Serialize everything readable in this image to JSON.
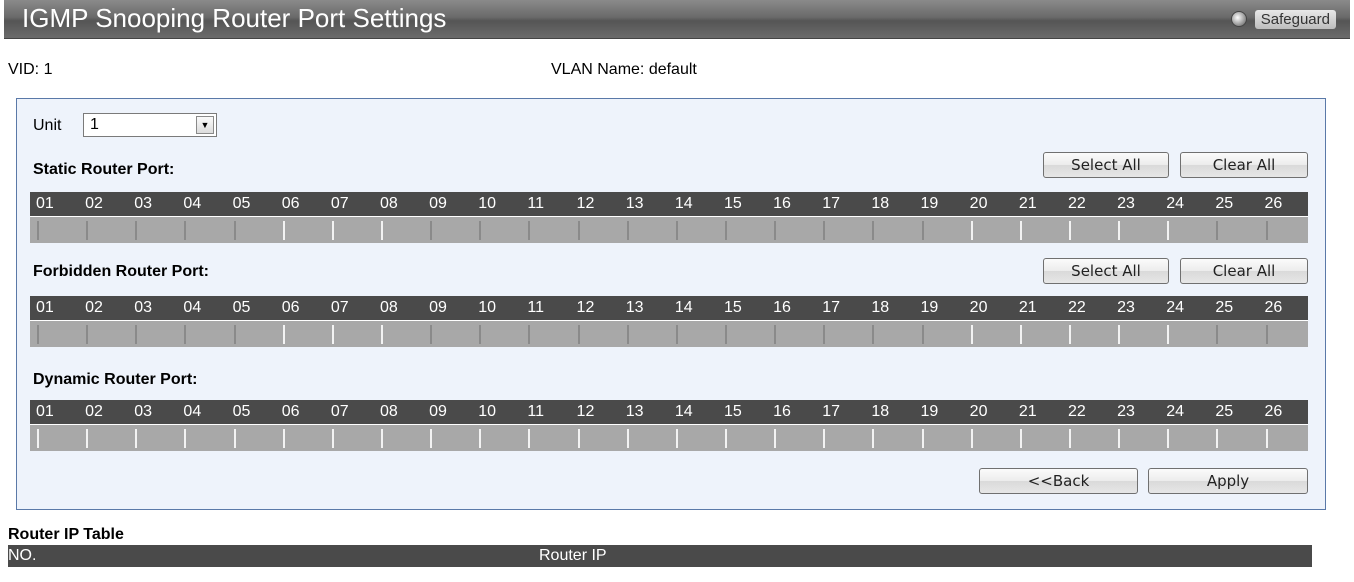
{
  "title": "IGMP Snooping Router Port Settings",
  "safeguard": "Safeguard",
  "vid": "VID:  1",
  "vlan_name": "VLAN Name:  default",
  "unit": {
    "label": "Unit",
    "value": "1"
  },
  "sections": [
    {
      "label": "Static Router Port:",
      "select_all": "Select All",
      "clear_all": "Clear All",
      "ports": [
        "01",
        "02",
        "03",
        "04",
        "05",
        "06",
        "07",
        "08",
        "09",
        "10",
        "11",
        "12",
        "13",
        "14",
        "15",
        "16",
        "17",
        "18",
        "19",
        "20",
        "21",
        "22",
        "23",
        "24",
        "25",
        "26"
      ],
      "enabled": [
        true,
        true,
        true,
        true,
        true,
        false,
        false,
        false,
        true,
        true,
        true,
        true,
        true,
        true,
        true,
        true,
        true,
        true,
        true,
        false,
        false,
        false,
        false,
        false,
        true,
        true
      ]
    },
    {
      "label": "Forbidden Router Port:",
      "select_all": "Select All",
      "clear_all": "Clear All",
      "ports": [
        "01",
        "02",
        "03",
        "04",
        "05",
        "06",
        "07",
        "08",
        "09",
        "10",
        "11",
        "12",
        "13",
        "14",
        "15",
        "16",
        "17",
        "18",
        "19",
        "20",
        "21",
        "22",
        "23",
        "24",
        "25",
        "26"
      ],
      "enabled": [
        true,
        true,
        true,
        true,
        true,
        false,
        false,
        false,
        true,
        true,
        true,
        true,
        true,
        true,
        true,
        true,
        true,
        true,
        true,
        false,
        false,
        false,
        false,
        false,
        true,
        true
      ]
    },
    {
      "label": "Dynamic Router Port:",
      "ports": [
        "01",
        "02",
        "03",
        "04",
        "05",
        "06",
        "07",
        "08",
        "09",
        "10",
        "11",
        "12",
        "13",
        "14",
        "15",
        "16",
        "17",
        "18",
        "19",
        "20",
        "21",
        "22",
        "23",
        "24",
        "25",
        "26"
      ],
      "enabled": [
        false,
        false,
        false,
        false,
        false,
        false,
        false,
        false,
        false,
        false,
        false,
        false,
        false,
        false,
        false,
        false,
        false,
        false,
        false,
        false,
        false,
        false,
        false,
        false,
        false,
        false
      ]
    }
  ],
  "back_label": "<<Back",
  "apply_label": "Apply",
  "router_ip_table": {
    "title": "Router IP Table",
    "col_no": "NO.",
    "col_ip": "Router IP"
  }
}
